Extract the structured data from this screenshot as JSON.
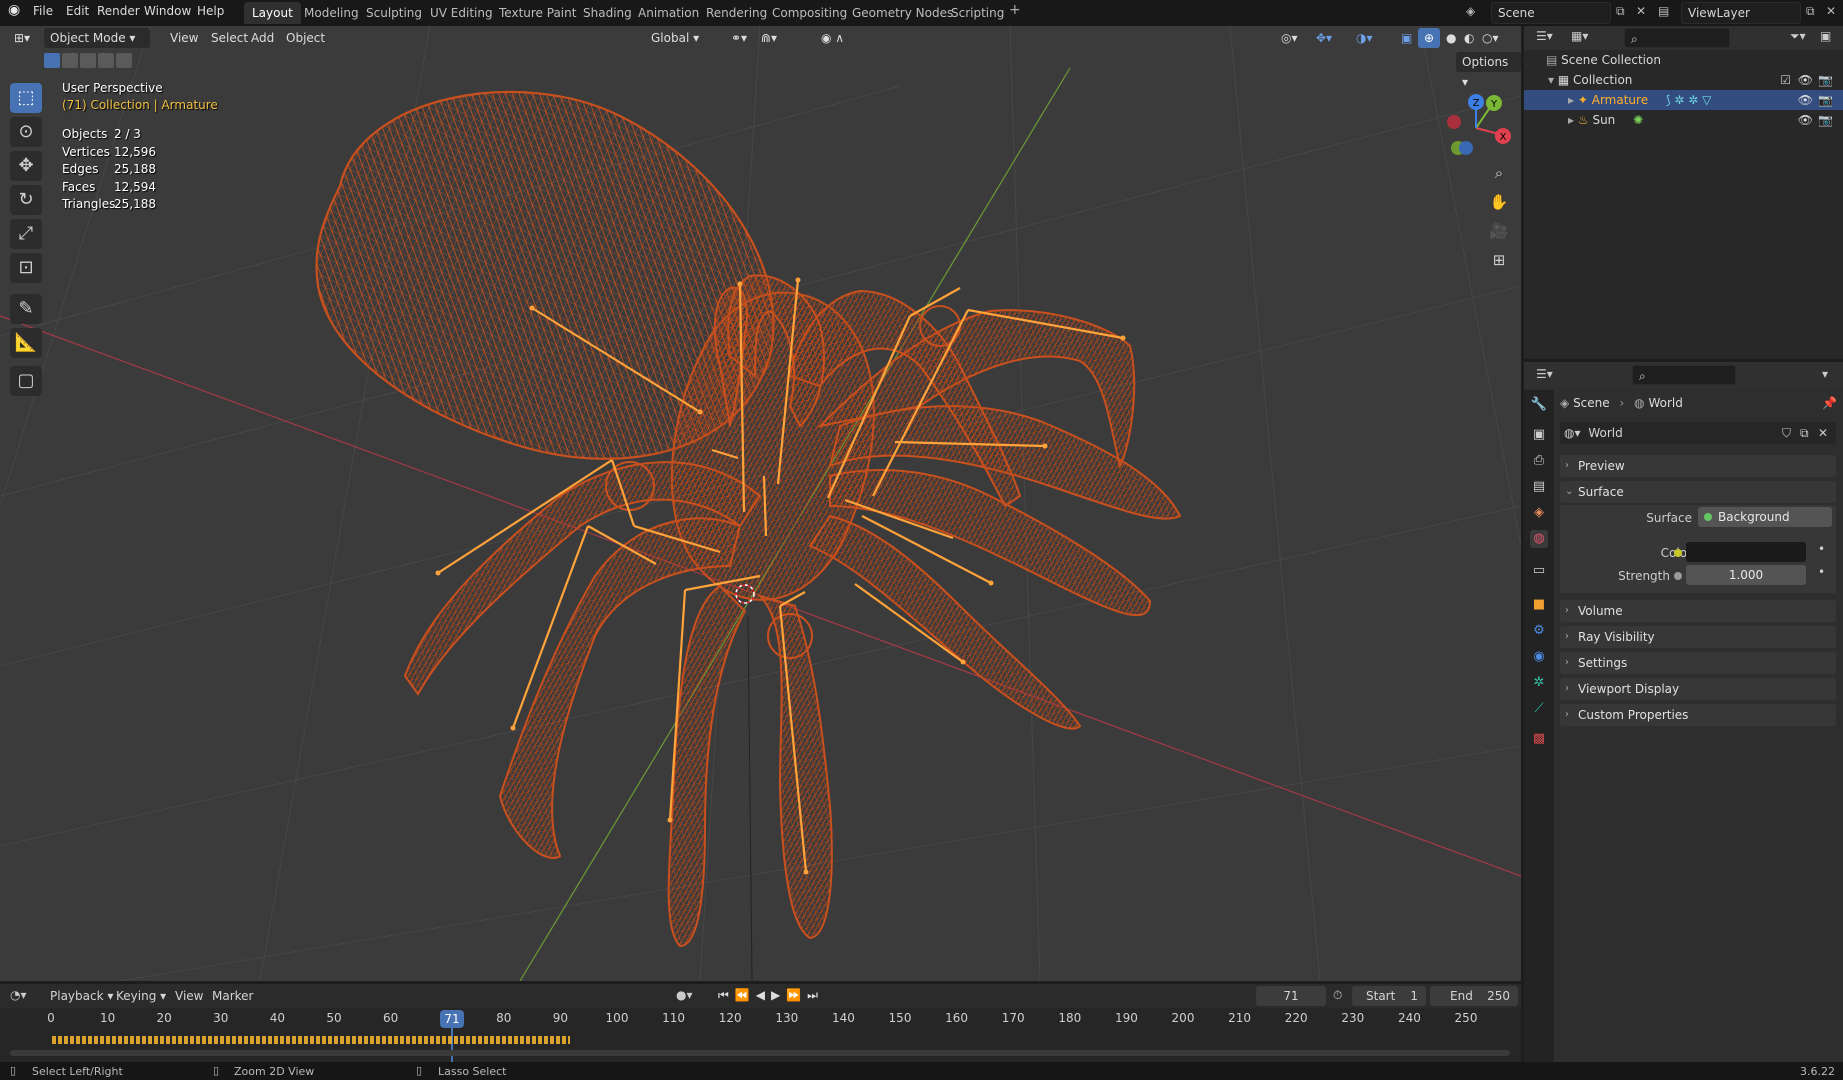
{
  "menu": [
    "File",
    "Edit",
    "Render",
    "Window",
    "Help"
  ],
  "workspaces": [
    "Layout",
    "Modeling",
    "Sculpting",
    "UV Editing",
    "Texture Paint",
    "Shading",
    "Animation",
    "Rendering",
    "Compositing",
    "Geometry Nodes",
    "Scripting"
  ],
  "active_workspace": "Layout",
  "scene_name": "Scene",
  "view_layer": "ViewLayer",
  "viewport": {
    "mode": "Object Mode",
    "menus": [
      "View",
      "Select",
      "Add",
      "Object"
    ],
    "orientation": "Global",
    "options_label": "Options",
    "perspective": "User Perspective",
    "context": "(71) Collection | Armature",
    "stats": [
      {
        "label": "Objects",
        "value": "2 / 3"
      },
      {
        "label": "Vertices",
        "value": "12,596"
      },
      {
        "label": "Edges",
        "value": "25,188"
      },
      {
        "label": "Faces",
        "value": "12,594"
      },
      {
        "label": "Triangles",
        "value": "25,188"
      }
    ],
    "gizmo": {
      "x": "X",
      "y": "Y",
      "z": "Z"
    }
  },
  "outliner": {
    "root": "Scene Collection",
    "collection": "Collection",
    "items": [
      "Armature",
      "Sun"
    ]
  },
  "properties": {
    "breadcrumb": [
      "Scene",
      "World"
    ],
    "world_name": "World",
    "panels": {
      "preview": "Preview",
      "surface": "Surface",
      "volume": "Volume",
      "ray_visibility": "Ray Visibility",
      "settings": "Settings",
      "viewport_display": "Viewport Display",
      "custom_properties": "Custom Properties"
    },
    "surface_label": "Surface",
    "surface_value": "Background",
    "color_label": "Color",
    "strength_label": "Strength",
    "strength_value": "1.000"
  },
  "timeline": {
    "menus": [
      "Playback",
      "Keying",
      "View",
      "Marker"
    ],
    "current_frame": "71",
    "start_label": "Start",
    "start": "1",
    "end_label": "End",
    "end": "250",
    "ticks": [
      "0",
      "10",
      "20",
      "30",
      "40",
      "50",
      "60",
      "70",
      "80",
      "90",
      "100",
      "110",
      "120",
      "130",
      "140",
      "150",
      "160",
      "170",
      "180",
      "190",
      "200",
      "210",
      "220",
      "230",
      "240",
      "250"
    ]
  },
  "statusbar": {
    "left": "Select Left/Right",
    "middle": "Zoom 2D View",
    "right": "Lasso Select",
    "version": "3.6.22"
  },
  "colors": {
    "accent": "#4772b3",
    "wire": "#c8501e",
    "bone": "#ffa33a",
    "selected": "#ffaf29"
  }
}
